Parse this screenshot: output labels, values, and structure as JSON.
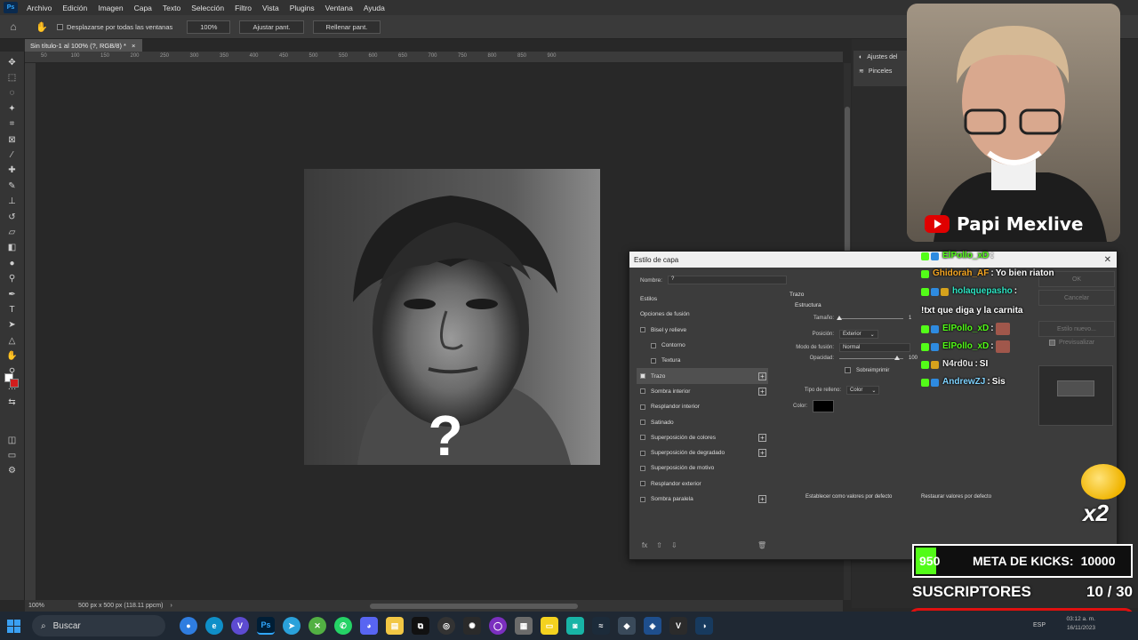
{
  "menu": [
    "Archivo",
    "Edición",
    "Imagen",
    "Capa",
    "Texto",
    "Selección",
    "Filtro",
    "Vista",
    "Plugins",
    "Ventana",
    "Ayuda"
  ],
  "options": {
    "scroll_all": "Desplazarse por todas las ventanas",
    "zoom": "100%",
    "fit": "Ajustar pant.",
    "fill": "Rellenar pant."
  },
  "document": {
    "tab": "Sin título-1 al 100% (?, RGB/8) *",
    "status_zoom": "100%",
    "status_info": "500 px x 500 px (118.11 ppcm)",
    "overlay_symbol": "?"
  },
  "ruler": [
    "50",
    "100",
    "150",
    "200",
    "250",
    "300",
    "350",
    "400",
    "450",
    "500",
    "550",
    "600",
    "650",
    "700",
    "750",
    "800",
    "850",
    "900"
  ],
  "right_panel": {
    "adjustments": "Ajustes del",
    "brushes": "Pinceles"
  },
  "dialog": {
    "title": "Estilo de capa",
    "name_label": "Nombre:",
    "name_value": "?",
    "items": [
      {
        "label": "Estilos",
        "kind": "head",
        "checked": false,
        "plus": false
      },
      {
        "label": "Opciones de fusión",
        "kind": "head",
        "checked": false,
        "plus": false
      },
      {
        "label": "Bisel y relieve",
        "kind": "item",
        "checked": false,
        "plus": false
      },
      {
        "label": "Contorno",
        "kind": "sub",
        "checked": false,
        "plus": false
      },
      {
        "label": "Textura",
        "kind": "sub",
        "checked": false,
        "plus": false
      },
      {
        "label": "Trazo",
        "kind": "item",
        "checked": true,
        "plus": true,
        "selected": true
      },
      {
        "label": "Sombra interior",
        "kind": "item",
        "checked": false,
        "plus": true
      },
      {
        "label": "Resplandor interior",
        "kind": "item",
        "checked": false,
        "plus": false
      },
      {
        "label": "Satinado",
        "kind": "item",
        "checked": false,
        "plus": false
      },
      {
        "label": "Superposición de colores",
        "kind": "item",
        "checked": false,
        "plus": true
      },
      {
        "label": "Superposición de degradado",
        "kind": "item",
        "checked": false,
        "plus": true
      },
      {
        "label": "Superposición de motivo",
        "kind": "item",
        "checked": false,
        "plus": false
      },
      {
        "label": "Resplandor exterior",
        "kind": "item",
        "checked": false,
        "plus": false
      },
      {
        "label": "Sombra paralela",
        "kind": "item",
        "checked": false,
        "plus": true
      }
    ],
    "section": "Trazo",
    "subsection": "Estructura",
    "size_label": "Tamaño:",
    "size_value": "1",
    "position_label": "Posición:",
    "position_value": "Exterior",
    "blend_label": "Modo de fusión:",
    "blend_value": "Normal",
    "opacity_label": "Opacidad:",
    "opacity_value": "100",
    "overprint": "Sobreimprimir",
    "fill_type_label": "Tipo de relleno:",
    "fill_type_value": "Color",
    "color_label": "Color:",
    "set_default": "Establecer como valores por defecto",
    "reset_default": "Restaurar valores por defecto",
    "ok": "OK",
    "cancel": "Cancelar",
    "new_style": "Estilo nuevo...",
    "preview": "Previsualizar",
    "fx": "fx"
  },
  "webcam": {
    "channel": "Papi Mexlive"
  },
  "chat": [
    {
      "user": "ElPollo_xD",
      "msg": "",
      "color": "#53fc18",
      "badges": [
        "b-green",
        "b-blue"
      ],
      "emote": false
    },
    {
      "user": "Ghidorah_AF",
      "msg": "Yo bien riaton",
      "color": "#f5a623",
      "badges": [
        "b-green"
      ],
      "emote": false
    },
    {
      "user": "holaquepasho",
      "msg": "!txt que diga y la carnita",
      "color": "#2ee6c4",
      "badges": [
        "b-green",
        "b-blue",
        "b-gold"
      ],
      "emote": false
    },
    {
      "user": "ElPollo_xD",
      "msg": "",
      "color": "#53fc18",
      "badges": [
        "b-green",
        "b-blue"
      ],
      "emote": true
    },
    {
      "user": "ElPollo_xD",
      "msg": "",
      "color": "#53fc18",
      "badges": [
        "b-green",
        "b-blue"
      ],
      "emote": true
    },
    {
      "user": "N4rd0u",
      "msg": "SI",
      "color": "#e8e8e8",
      "badges": [
        "b-green",
        "b-gold"
      ],
      "emote": false
    },
    {
      "user": "AndrewZJ",
      "msg": "Sis",
      "color": "#7fd3ff",
      "badges": [
        "b-green",
        "b-blue"
      ],
      "emote": false
    }
  ],
  "overlay": {
    "multiplier": "x2",
    "kicks_current": "950",
    "kicks_label": "META DE KICKS:",
    "kicks_goal": "10000",
    "kicks_progress": 0.095,
    "subs_label": "SUSCRIPTORES",
    "subs_value": "10 / 30",
    "subs_progress": 0.33
  },
  "taskbar": {
    "search": "Buscar",
    "lang": "ESP",
    "time": "03:12 a. m.",
    "date": "16/11/2023"
  },
  "colors": {
    "accent": "#31a8ff",
    "kick_green": "#53fc18",
    "youtube_red": "#e00000",
    "sub_border": "#e01010"
  }
}
